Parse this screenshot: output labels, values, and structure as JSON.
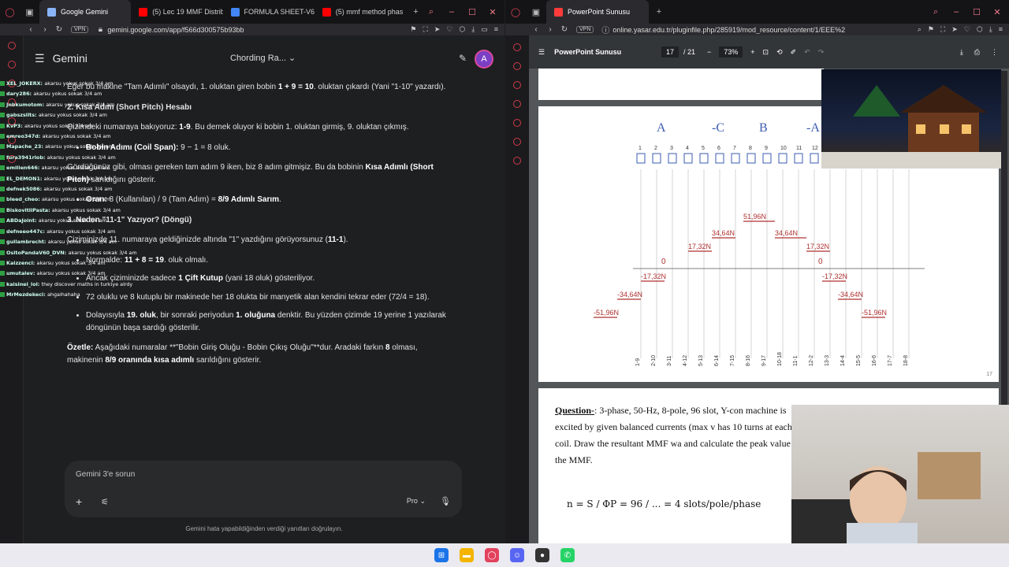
{
  "left": {
    "tabs": [
      {
        "label": "Google Gemini",
        "color": "#8ab4f8",
        "active": true
      },
      {
        "label": "(5) Lec 19 MMF Distrib",
        "color": "#ff0000"
      },
      {
        "label": "FORMULA SHEET-V6",
        "color": "#4285f4"
      },
      {
        "label": "(5) mmf method phas",
        "color": "#ff0000"
      }
    ],
    "url": "gemini.google.com/app/f566d300575b93bb",
    "vpn": "VPN",
    "gemini": {
      "title": "Gemini",
      "chat_title": "Chording Ra...",
      "avatar": "A",
      "p1_a": "Eğer bu makine \"Tam Adımlı\" olsaydı, 1. oluktan giren bobin ",
      "p1_math": "1 + 9 = 10",
      "p1_b": ". oluktan çıkardı (Yani \"1-10\" yazardı).",
      "h2": "2. Kısa Adım (Short Pitch) Hesabı",
      "p2_a": "Çizimdeki numaraya bakıyoruz: ",
      "p2_b": "1-9",
      "p2_c": ". Bu demek oluyor ki bobin 1. oluktan girmiş, 9. oluktan çıkmış.",
      "li1_a": "Bobin Adımı (Coil Span): ",
      "li1_b": "9 − 1 = 8",
      "li1_c": " oluk.",
      "p3_a": "Gördüğünüz gibi, olması gereken tam adım 9 iken, biz 8 adım gitmişiz. Bu da bobinin ",
      "p3_b": "Kısa Adımlı (Short Pitch)",
      "p3_c": " sarıldığını gösterir.",
      "li2_a": "Oran: ",
      "li2_b": "8",
      "li2_c": " (Kullanılan) / 9 (Tam Adım) = ",
      "li2_d": "8/9 Adımlı Sarım",
      "li2_e": ".",
      "h3": "3. Neden \"11-1\" Yazıyor? (Döngü)",
      "p4_a": "Çiziminizde 11. numaraya geldiğinizde altında \"1\" yazdığını görüyorsunuz (",
      "p4_b": "11-1",
      "p4_c": ").",
      "li3_a": "Normalde: ",
      "li3_b": "11 + 8 = 19",
      "li3_c": ". oluk olmalı.",
      "li4_a": "Ancak çiziminizde sadece ",
      "li4_b": "1 Çift Kutup",
      "li4_c": " (yani 18 oluk) gösteriliyor.",
      "li5_a": "72 oluklu ve 8 kutuplu bir makinede her 18 olukta bir manyetik alan kendini tekrar eder (",
      "li5_b": "72/4 = 18",
      "li5_c": ").",
      "li6_a": "Dolayısıyla ",
      "li6_b": "19. oluk",
      "li6_c": ", bir sonraki periyodun ",
      "li6_d": "1. oluğuna",
      "li6_e": " denktir. Bu yüzden çizimde 19 yerine 1 yazılarak döngünün başa sardığı gösterilir.",
      "p5_a": "Özetle:",
      "p5_b": " Aşağıdaki numaralar **\"Bobin Giriş Oluğu - Bobin Çıkış Oluğu\"**dur. Aradaki farkın ",
      "p5_c": "8",
      "p5_d": " olması, makinenin ",
      "p5_e": "8/9 oranında kısa adımlı",
      "p5_f": " sarıldığını gösterir.",
      "input_placeholder": "Gemini 3'e sorun",
      "model": "Pro",
      "disclaimer": "Gemini hata yapabildiğinden verdiği yanıtları doğrulayın."
    },
    "chat_overlay": [
      {
        "user": "XEL_JOKERX:",
        "msg": "akarsu yokus sokak 3/4 am"
      },
      {
        "user": "dary286:",
        "msg": "akarsu yokus sokak 3/4 am"
      },
      {
        "user": "Jnbkumotom:",
        "msg": "akarsu yokus sokak 3/4 am"
      },
      {
        "user": "gabszsllts:",
        "msg": "akarsu yokus sokak 3/4 am"
      },
      {
        "user": "KvP3:",
        "msg": "akarsu yokus sokak 3/4 am"
      },
      {
        "user": "emreo347d:",
        "msg": "akarsu yokus sokak 3/4 am"
      },
      {
        "user": "Mapache_23:",
        "msg": "akarsu yokus sokak 3/4 am"
      },
      {
        "user": "fura3941rlob:",
        "msg": "akarsu yokus sokak 3/4 am"
      },
      {
        "user": "emilien646:",
        "msg": "akarsu yokus sokak 3/4 am"
      },
      {
        "user": "EL_DEMON1:",
        "msg": "akarsu yokus sokak 3/4 am"
      },
      {
        "user": "defnek5086:",
        "msg": "akarsu yokus sokak 3/4 am"
      },
      {
        "user": "bleed_cheo:",
        "msg": "akarsu yokus sokak 3/4 am"
      },
      {
        "user": "BiskovitliPasta:",
        "msg": "akarsu yokus sokak 3/4 am"
      },
      {
        "user": "ABDaJoint:",
        "msg": "akarsu yokus sokak 3/4 am"
      },
      {
        "user": "defneeo447c:",
        "msg": "akarsu yokus sokak 3/4 am"
      },
      {
        "user": "gullambrecht:",
        "msg": "akarsu yokus sokak 3/4 am"
      },
      {
        "user": "OsitoPandaV60_DVN:",
        "msg": "akarsu yokus sokak 3/4 am"
      },
      {
        "user": "Kaizzenci:",
        "msg": "akarsu yokus sokak 3/4 am"
      },
      {
        "user": "umutalev:",
        "msg": "akarsu yokus sokak 3/4 am"
      },
      {
        "user": "kaisinel_lol:",
        "msg": "they discover maths in turkiye alrdy"
      },
      {
        "user": "MrMezdekeci:",
        "msg": "ahgaihahaha"
      }
    ]
  },
  "right": {
    "tab": {
      "label": "PowerPoint Sunusu",
      "color": "#ff3b3b"
    },
    "url": "online.yasar.edu.tr/pluginfile.php/285919/mod_resource/content/1/EEE%2",
    "vpn": "VPN",
    "viewer": {
      "title": "PowerPoint Sunusu",
      "page_current": "17",
      "page_total": "/ 21",
      "zoom": "73%",
      "slide_number": "17",
      "phase_labels": [
        "A",
        "-C",
        "B",
        "-A"
      ],
      "slot_numbers": [
        "1",
        "2",
        "3",
        "4",
        "5",
        "6",
        "7",
        "8",
        "9",
        "10",
        "11",
        "12",
        "13",
        "14",
        "15",
        "16",
        "17",
        "18"
      ],
      "slot_pairs": [
        "1-9",
        "2-10",
        "3-11",
        "4-12",
        "5-13",
        "6-14",
        "7-15",
        "8-16",
        "9-17",
        "10-18",
        "11-1",
        "12-2",
        "13-3",
        "14-4",
        "15-5",
        "16-6",
        "17-7",
        "18-8"
      ],
      "mmf_labels": [
        "51,96N",
        "34,64N",
        "34,64N",
        "17,32N",
        "17,32N",
        "0",
        "0",
        "-17,32N",
        "-17,32N",
        "-34,64N",
        "-34,64N",
        "-51,96N",
        "-51,96N"
      ],
      "question_label": "Question-",
      "question_text": ": 3-phase, 50-Hz, 8-pole, 96 slot, Y-con machine is excited by given balanced currents (max v has 10 turns at each coil. Draw the resultant MMF wa and calculate the peak value of the MMF.",
      "formula": "n = S / ΦP = 96 / ... = 4 slots/pole/phase"
    }
  }
}
